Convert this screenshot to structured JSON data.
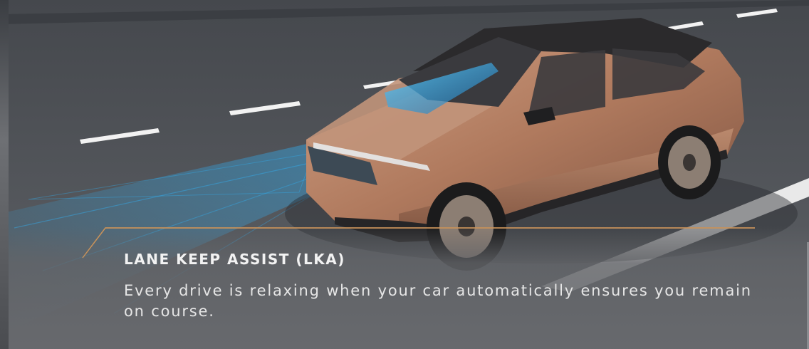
{
  "feature": {
    "title": "LANE KEEP ASSIST (LKA)",
    "description": "Every drive is relaxing when your car automatically ensures you remain on course."
  },
  "colors": {
    "accent_line": "#c8925a",
    "car_body": "#b07a5e",
    "sensor_blue": "#2fb6ff",
    "lane_marking": "#f2f2f2"
  },
  "icons": {
    "illustration": "car-with-lane-assist-sensors"
  }
}
